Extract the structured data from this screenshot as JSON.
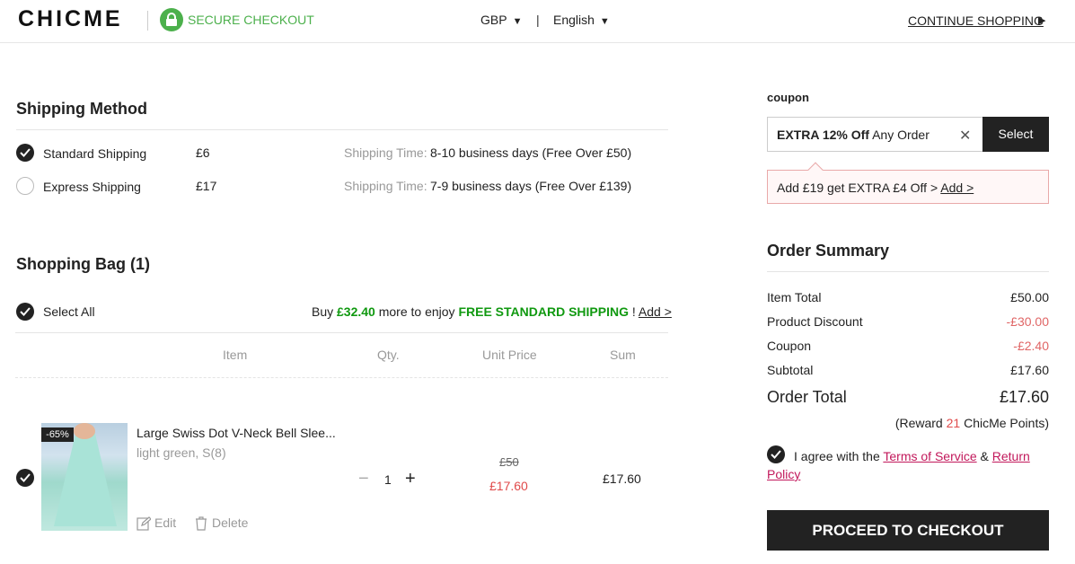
{
  "header": {
    "logo": "CHICME",
    "secure": "SECURE CHECKOUT",
    "currency": "GBP",
    "separator": "|",
    "language": "English",
    "continue": "CONTINUE SHOPPING"
  },
  "shipping": {
    "title": "Shipping Method",
    "time_label": "Shipping Time:",
    "options": [
      {
        "name": "Standard Shipping",
        "price": "£6",
        "time": "8-10 business days (Free Over £50)",
        "selected": true
      },
      {
        "name": "Express Shipping",
        "price": "£17",
        "time": "7-9 business days (Free Over £139)",
        "selected": false
      }
    ]
  },
  "bag": {
    "title": "Shopping Bag (1)",
    "select_all": "Select All",
    "promo_buy": "Buy",
    "promo_amount": "£32.40",
    "promo_mid": "more to enjoy",
    "promo_free": "FREE STANDARD SHIPPING",
    "promo_bang": "!",
    "promo_add": "Add >",
    "columns": {
      "item": "Item",
      "qty": "Qty.",
      "unit_price": "Unit Price",
      "sum": "Sum"
    },
    "product": {
      "discount_badge": "-65%",
      "name": "Large Swiss Dot V-Neck Bell Slee...",
      "variant": "light green, S(8)",
      "qty": "1",
      "original_price": "£50",
      "price": "£17.60",
      "sum": "£17.60",
      "edit": "Edit",
      "delete": "Delete"
    }
  },
  "coupon": {
    "label": "coupon",
    "code_bold": "EXTRA 12% Off",
    "code_rest": "Any Order",
    "select": "Select",
    "promo_text": "Add £19 get EXTRA £4 Off >",
    "promo_link": "Add >"
  },
  "summary": {
    "title": "Order Summary",
    "rows": [
      {
        "label": "Item Total",
        "value": "£50.00"
      },
      {
        "label": "Product Discount",
        "value": "-£30.00"
      },
      {
        "label": "Coupon",
        "value": "-£2.40"
      },
      {
        "label": "Subtotal",
        "value": "£17.60"
      }
    ],
    "order_total_label": "Order Total",
    "order_total_value": "£17.60",
    "reward_pre": "(Reward",
    "reward_points": "21",
    "reward_post": "ChicMe Points)",
    "agree_pre": "I agree with the",
    "terms": "Terms of Service",
    "amp": "&",
    "return_1": "Return",
    "return_2": "Policy",
    "checkout": "PROCEED TO CHECKOUT"
  },
  "colors": {
    "accent_green": "#4cb04c",
    "free_green": "#109910",
    "price_red": "#e04a4a",
    "link_pink": "#c2185b",
    "dark": "#222222"
  }
}
